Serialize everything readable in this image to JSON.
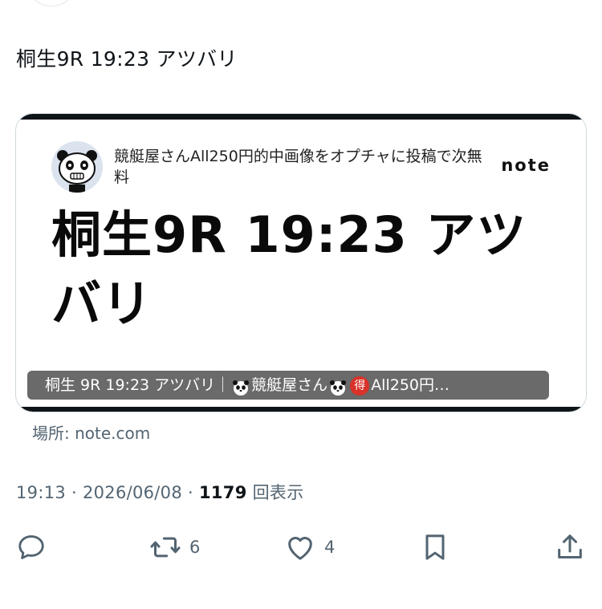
{
  "tweet": {
    "text": "桐生9R 19:23 アツバリ"
  },
  "card": {
    "author_line": "競艇屋さんAll250円的中画像をオプチャに投稿で次無料",
    "logo": "note",
    "title": "桐生9R 19:23 アツバリ",
    "caption_part1": "桐生 9R 19:23 アツバリ｜",
    "caption_part2": "競艇屋さん",
    "caption_badge": "得",
    "caption_part3": "All250円…",
    "source": "場所: note.com"
  },
  "meta": {
    "time": "19:13",
    "date": "2026/06/08",
    "views": "1179",
    "views_label": "回表示"
  },
  "actions": {
    "reply_icon": "reply-icon",
    "retweet_icon": "retweet-icon",
    "retweet_count": "6",
    "like_icon": "heart-icon",
    "like_count": "4",
    "bookmark_icon": "bookmark-icon",
    "share_icon": "share-icon"
  },
  "colors": {
    "text": "#0f1419",
    "muted": "#536471",
    "card_border": "#cfd9de",
    "caption_bg": "#404040",
    "badge": "#d8322a"
  }
}
